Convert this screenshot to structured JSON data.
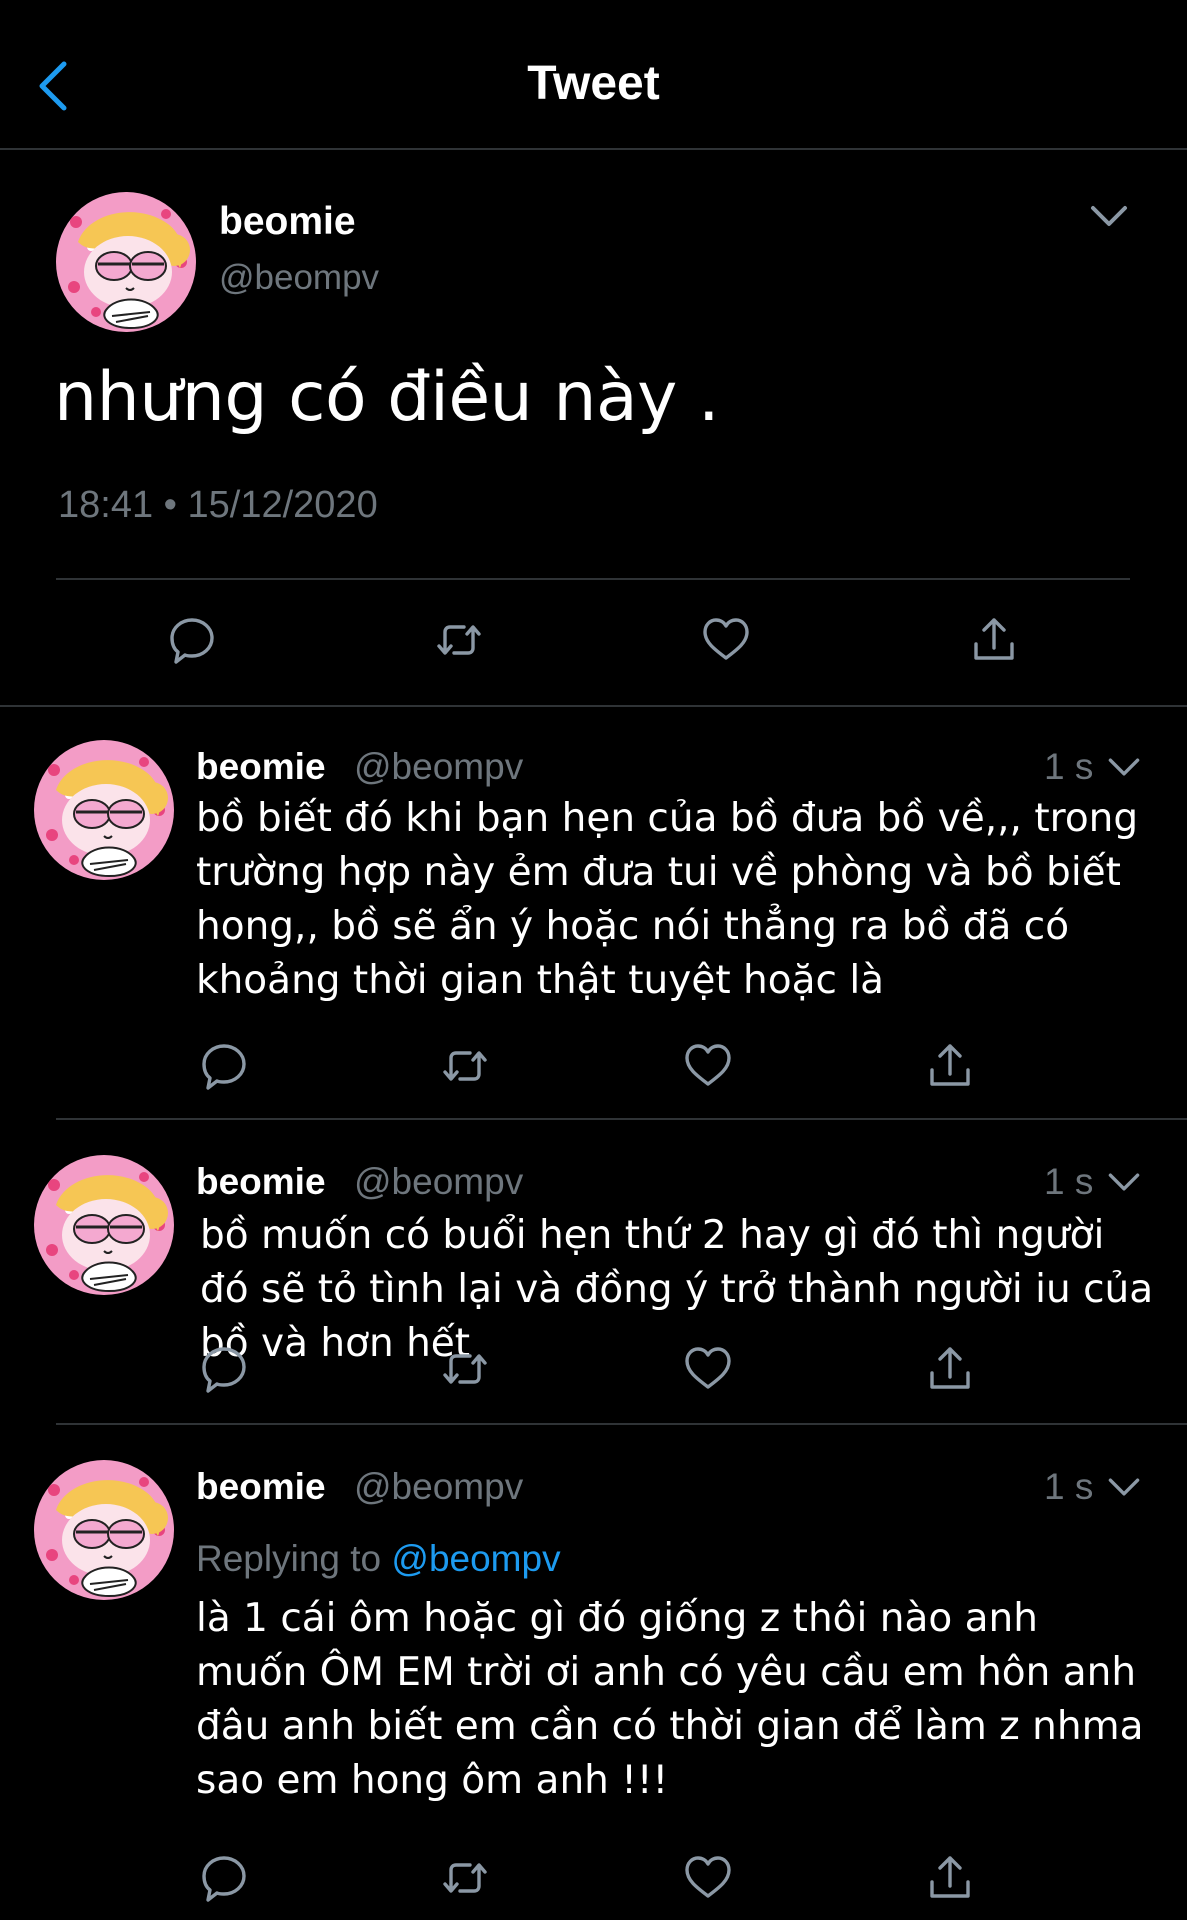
{
  "header": {
    "title": "Tweet",
    "back_icon": "chevron-left-icon",
    "accent": "#1d9bf0"
  },
  "main_tweet": {
    "name": "beomie",
    "handle": "@beompv",
    "text": "nhưng có điều này .",
    "timestamp": "18:41 • 15/12/2020",
    "actions": [
      "reply-icon",
      "retweet-icon",
      "like-icon",
      "share-icon"
    ]
  },
  "replies": [
    {
      "name": "beomie",
      "handle": "@beompv",
      "time": "1 s",
      "text": "bồ biết đó khi bạn hẹn của bồ đưa bồ về,,, trong trường hợp này ẻm đưa tui về phòng và bồ biết hong,, bồ sẽ ẩn ý hoặc nói thẳng ra bồ đã có khoảng thời gian thật tuyệt hoặc là"
    },
    {
      "name": "beomie",
      "handle": "@beompv",
      "time": "1 s",
      "text": "bồ muốn có buổi hẹn thứ 2 hay gì đó thì người đó sẽ tỏ tình lại và đồng ý trở thành người iu của bồ và hơn hết"
    },
    {
      "name": "beomie",
      "handle": "@beompv",
      "time": "1 s",
      "replying_label": "Replying to",
      "replying_to": "@beompv",
      "text": "là 1 cái ôm hoặc gì đó giống z thôi nào anh muốn ÔM EM trời ơi anh có yêu cầu em hôn anh đâu anh biết em cần có thời gian để làm z nhma sao em hong ôm anh !!!"
    }
  ],
  "colors": {
    "background": "#000000",
    "text": "#ffffff",
    "secondary": "#6e767d",
    "divider": "#2f3336",
    "mention": "#1d9bf0"
  }
}
